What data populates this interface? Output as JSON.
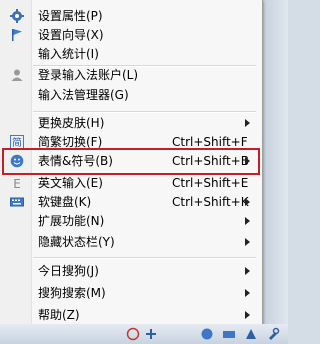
{
  "menu": {
    "items": [
      {
        "label": "设置属性(P)"
      },
      {
        "label": "设置向导(X)"
      },
      {
        "label": "输入统计(I)"
      },
      {
        "label": "登录输入法账户(L)"
      },
      {
        "label": "输入法管理器(G)"
      },
      {
        "label": "更换皮肤(H)"
      },
      {
        "label": "简繁切换(F)",
        "shortcut": "Ctrl+Shift+F"
      },
      {
        "label": "表情&符号(B)",
        "shortcut": "Ctrl+Shift+B"
      },
      {
        "label": "英文输入(E)",
        "shortcut": "Ctrl+Shift+E"
      },
      {
        "label": "软键盘(K)",
        "shortcut": "Ctrl+Shift+K"
      },
      {
        "label": "扩展功能(N)"
      },
      {
        "label": "隐藏状态栏(Y)"
      },
      {
        "label": "今日搜狗(J)"
      },
      {
        "label": "搜狗搜索(M)"
      },
      {
        "label": "帮助(Z)"
      }
    ]
  },
  "colors": {
    "highlight_border": "#c41f25",
    "menu_bg": "#f7f7f7"
  },
  "taskbar": {
    "icon_names": [
      "input-mode-icon",
      "punct-icon",
      "emoji-icon",
      "keyboard-icon",
      "skin-icon",
      "tools-icon"
    ]
  }
}
